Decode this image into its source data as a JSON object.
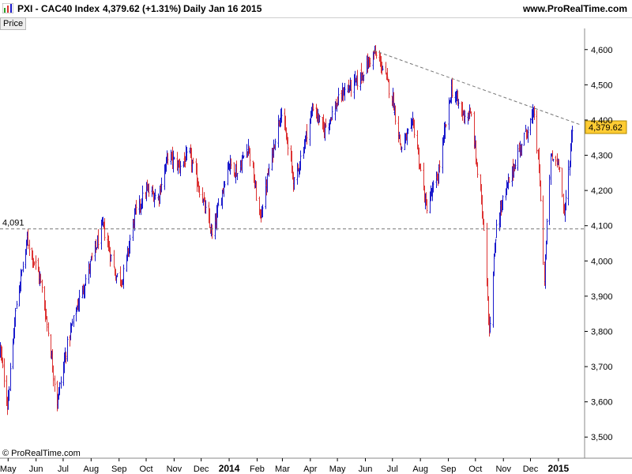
{
  "header": {
    "symbol": "PXI - CAC40 Index",
    "quote": "4,379.62 (+1.31%)",
    "period": "Daily  Jan 16 2015",
    "site": "www.ProRealTime.com"
  },
  "panel_label": "Price",
  "watermark": "© ProRealTime.com",
  "colors": {
    "up": "#1a1acc",
    "down": "#dd3333",
    "last_price_bg": "#ffcc33",
    "dashed": "#777777"
  },
  "chart_data": {
    "type": "ohlc",
    "title": "PXI - CAC40 Index",
    "ylim": [
      3440,
      4660
    ],
    "yticks": [
      {
        "value": 3500,
        "label": "3,500"
      },
      {
        "value": 3600,
        "label": "3,600"
      },
      {
        "value": 3700,
        "label": "3,700"
      },
      {
        "value": 3800,
        "label": "3,800"
      },
      {
        "value": 3900,
        "label": "3,900"
      },
      {
        "value": 4000,
        "label": "4,000"
      },
      {
        "value": 4100,
        "label": "4,100"
      },
      {
        "value": 4200,
        "label": "4,200"
      },
      {
        "value": 4300,
        "label": "4,300"
      },
      {
        "value": 4400,
        "label": "4,400"
      },
      {
        "value": 4500,
        "label": "4,500"
      },
      {
        "value": 4600,
        "label": "4,600"
      }
    ],
    "x_range": [
      "2013-04-22",
      "2015-01-30"
    ],
    "xticks": [
      {
        "date": "2013-05-01",
        "label": "May",
        "bold": false
      },
      {
        "date": "2013-06-01",
        "label": "Jun",
        "bold": false
      },
      {
        "date": "2013-07-01",
        "label": "Jul",
        "bold": false
      },
      {
        "date": "2013-08-01",
        "label": "Aug",
        "bold": false
      },
      {
        "date": "2013-09-01",
        "label": "Sep",
        "bold": false
      },
      {
        "date": "2013-10-01",
        "label": "Oct",
        "bold": false
      },
      {
        "date": "2013-11-01",
        "label": "Nov",
        "bold": false
      },
      {
        "date": "2013-12-01",
        "label": "Dec",
        "bold": false
      },
      {
        "date": "2014-01-01",
        "label": "2014",
        "bold": true
      },
      {
        "date": "2014-02-01",
        "label": "Feb",
        "bold": false
      },
      {
        "date": "2014-03-01",
        "label": "Mar",
        "bold": false
      },
      {
        "date": "2014-04-01",
        "label": "Apr",
        "bold": false
      },
      {
        "date": "2014-05-01",
        "label": "May",
        "bold": false
      },
      {
        "date": "2014-06-01",
        "label": "Jun",
        "bold": false
      },
      {
        "date": "2014-07-01",
        "label": "Jul",
        "bold": false
      },
      {
        "date": "2014-08-01",
        "label": "Aug",
        "bold": false
      },
      {
        "date": "2014-09-01",
        "label": "Sep",
        "bold": false
      },
      {
        "date": "2014-10-01",
        "label": "Oct",
        "bold": false
      },
      {
        "date": "2014-11-01",
        "label": "Nov",
        "bold": false
      },
      {
        "date": "2014-12-01",
        "label": "Dec",
        "bold": false
      },
      {
        "date": "2015-01-01",
        "label": "2015",
        "bold": true
      }
    ],
    "last_price": {
      "value": 4379.62,
      "label": "4,379.62"
    },
    "support_line": {
      "value": 4091,
      "label": "4,091"
    },
    "trendline": [
      {
        "date": "2014-06-10",
        "value": 4598
      },
      {
        "date": "2015-01-26",
        "value": 4386
      }
    ],
    "anchors": [
      {
        "date": "2013-04-22",
        "value": 3750
      },
      {
        "date": "2013-04-30",
        "value": 3590
      },
      {
        "date": "2013-05-10",
        "value": 3880
      },
      {
        "date": "2013-05-22",
        "value": 4060
      },
      {
        "date": "2013-06-05",
        "value": 3950
      },
      {
        "date": "2013-06-12",
        "value": 3840
      },
      {
        "date": "2013-06-24",
        "value": 3600
      },
      {
        "date": "2013-07-05",
        "value": 3760
      },
      {
        "date": "2013-07-15",
        "value": 3860
      },
      {
        "date": "2013-07-31",
        "value": 3990
      },
      {
        "date": "2013-08-14",
        "value": 4100
      },
      {
        "date": "2013-08-28",
        "value": 3960
      },
      {
        "date": "2013-09-05",
        "value": 3950
      },
      {
        "date": "2013-09-18",
        "value": 4130
      },
      {
        "date": "2013-10-01",
        "value": 4200
      },
      {
        "date": "2013-10-14",
        "value": 4180
      },
      {
        "date": "2013-10-25",
        "value": 4300
      },
      {
        "date": "2013-11-06",
        "value": 4270
      },
      {
        "date": "2013-11-18",
        "value": 4300
      },
      {
        "date": "2013-12-05",
        "value": 4150
      },
      {
        "date": "2013-12-13",
        "value": 4070
      },
      {
        "date": "2013-12-31",
        "value": 4280
      },
      {
        "date": "2014-01-10",
        "value": 4250
      },
      {
        "date": "2014-01-22",
        "value": 4330
      },
      {
        "date": "2014-02-04",
        "value": 4120
      },
      {
        "date": "2014-02-14",
        "value": 4260
      },
      {
        "date": "2014-02-27",
        "value": 4430
      },
      {
        "date": "2014-03-14",
        "value": 4220
      },
      {
        "date": "2014-04-04",
        "value": 4440
      },
      {
        "date": "2014-04-15",
        "value": 4370
      },
      {
        "date": "2014-05-07",
        "value": 4480
      },
      {
        "date": "2014-05-23",
        "value": 4510
      },
      {
        "date": "2014-06-10",
        "value": 4590
      },
      {
        "date": "2014-06-18",
        "value": 4560
      },
      {
        "date": "2014-07-01",
        "value": 4460
      },
      {
        "date": "2014-07-10",
        "value": 4320
      },
      {
        "date": "2014-07-24",
        "value": 4390
      },
      {
        "date": "2014-08-07",
        "value": 4150
      },
      {
        "date": "2014-08-20",
        "value": 4240
      },
      {
        "date": "2014-09-04",
        "value": 4490
      },
      {
        "date": "2014-09-16",
        "value": 4420
      },
      {
        "date": "2014-09-26",
        "value": 4410
      },
      {
        "date": "2014-10-03",
        "value": 4250
      },
      {
        "date": "2014-10-10",
        "value": 4100
      },
      {
        "date": "2014-10-16",
        "value": 3800
      },
      {
        "date": "2014-10-24",
        "value": 4110
      },
      {
        "date": "2014-11-06",
        "value": 4220
      },
      {
        "date": "2014-11-20",
        "value": 4330
      },
      {
        "date": "2014-12-05",
        "value": 4420
      },
      {
        "date": "2014-12-11",
        "value": 4220
      },
      {
        "date": "2014-12-16",
        "value": 3950
      },
      {
        "date": "2014-12-23",
        "value": 4290
      },
      {
        "date": "2015-01-02",
        "value": 4280
      },
      {
        "date": "2015-01-07",
        "value": 4120
      },
      {
        "date": "2015-01-13",
        "value": 4290
      },
      {
        "date": "2015-01-16",
        "value": 4380
      }
    ]
  }
}
